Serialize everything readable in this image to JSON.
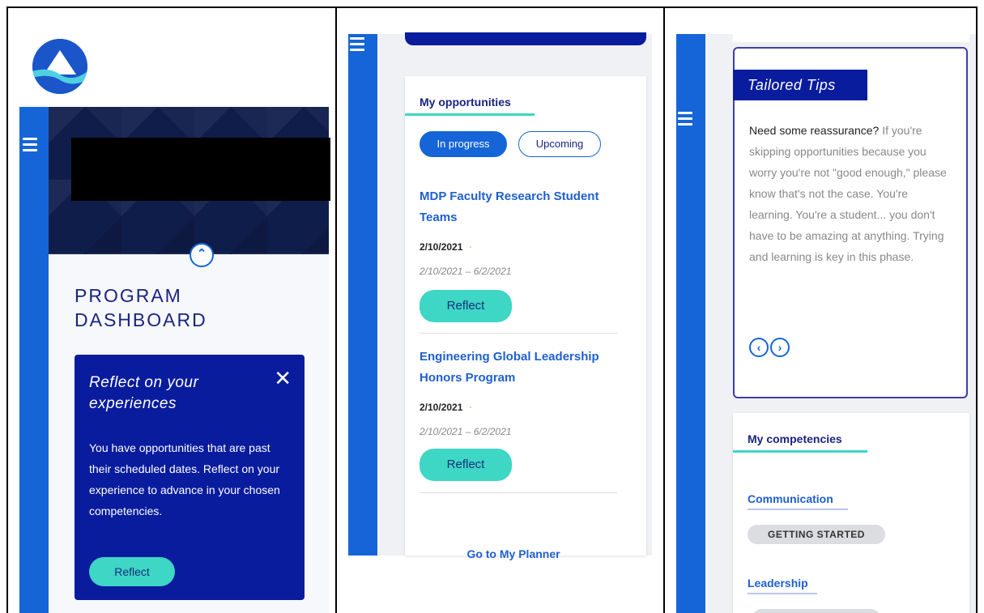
{
  "panel1": {
    "page_title": "PROGRAM\nDASHBOARD",
    "reflect_card": {
      "heading": "Reflect on your experiences",
      "close_glyph": "✕",
      "message": "You have opportunities that are past their scheduled dates. Reflect on your experience to advance in your chosen competencies.",
      "button_label": "Reflect"
    },
    "collapse_glyph": "⌃"
  },
  "panel2": {
    "section_title": "My opportunities",
    "tabs": [
      {
        "label": "In progress",
        "active": true
      },
      {
        "label": "Upcoming",
        "active": false
      }
    ],
    "opportunities": [
      {
        "title": "MDP Faculty Research Student Teams",
        "date": "2/10/2021",
        "range": "2/10/2021 – 6/2/2021",
        "button_label": "Reflect"
      },
      {
        "title": "Engineering Global Leadership Honors Program",
        "date": "2/10/2021",
        "range": "2/10/2021 – 6/2/2021",
        "button_label": "Reflect"
      }
    ],
    "planner_link": "Go to My Planner"
  },
  "panel3": {
    "tips_label": "Tailored Tips",
    "tips_lead": "Need some reassurance?",
    "tips_body": " If you're skipping opportunities because you worry you're not \"good enough,\" please know that's not the case. You're learning. You're a student... you don't have to be amazing at anything. Trying and learning is key in this phase.",
    "prev_glyph": "‹",
    "next_glyph": "›",
    "competencies_title": "My competencies",
    "competencies": [
      {
        "name": "Communication",
        "status": "GETTING STARTED"
      },
      {
        "name": "Leadership",
        "status": ""
      }
    ]
  },
  "colors": {
    "brand_blue": "#1565d8",
    "navy": "#0a1c9e",
    "teal": "#3ed6c5",
    "link_blue": "#1f5fcf"
  }
}
